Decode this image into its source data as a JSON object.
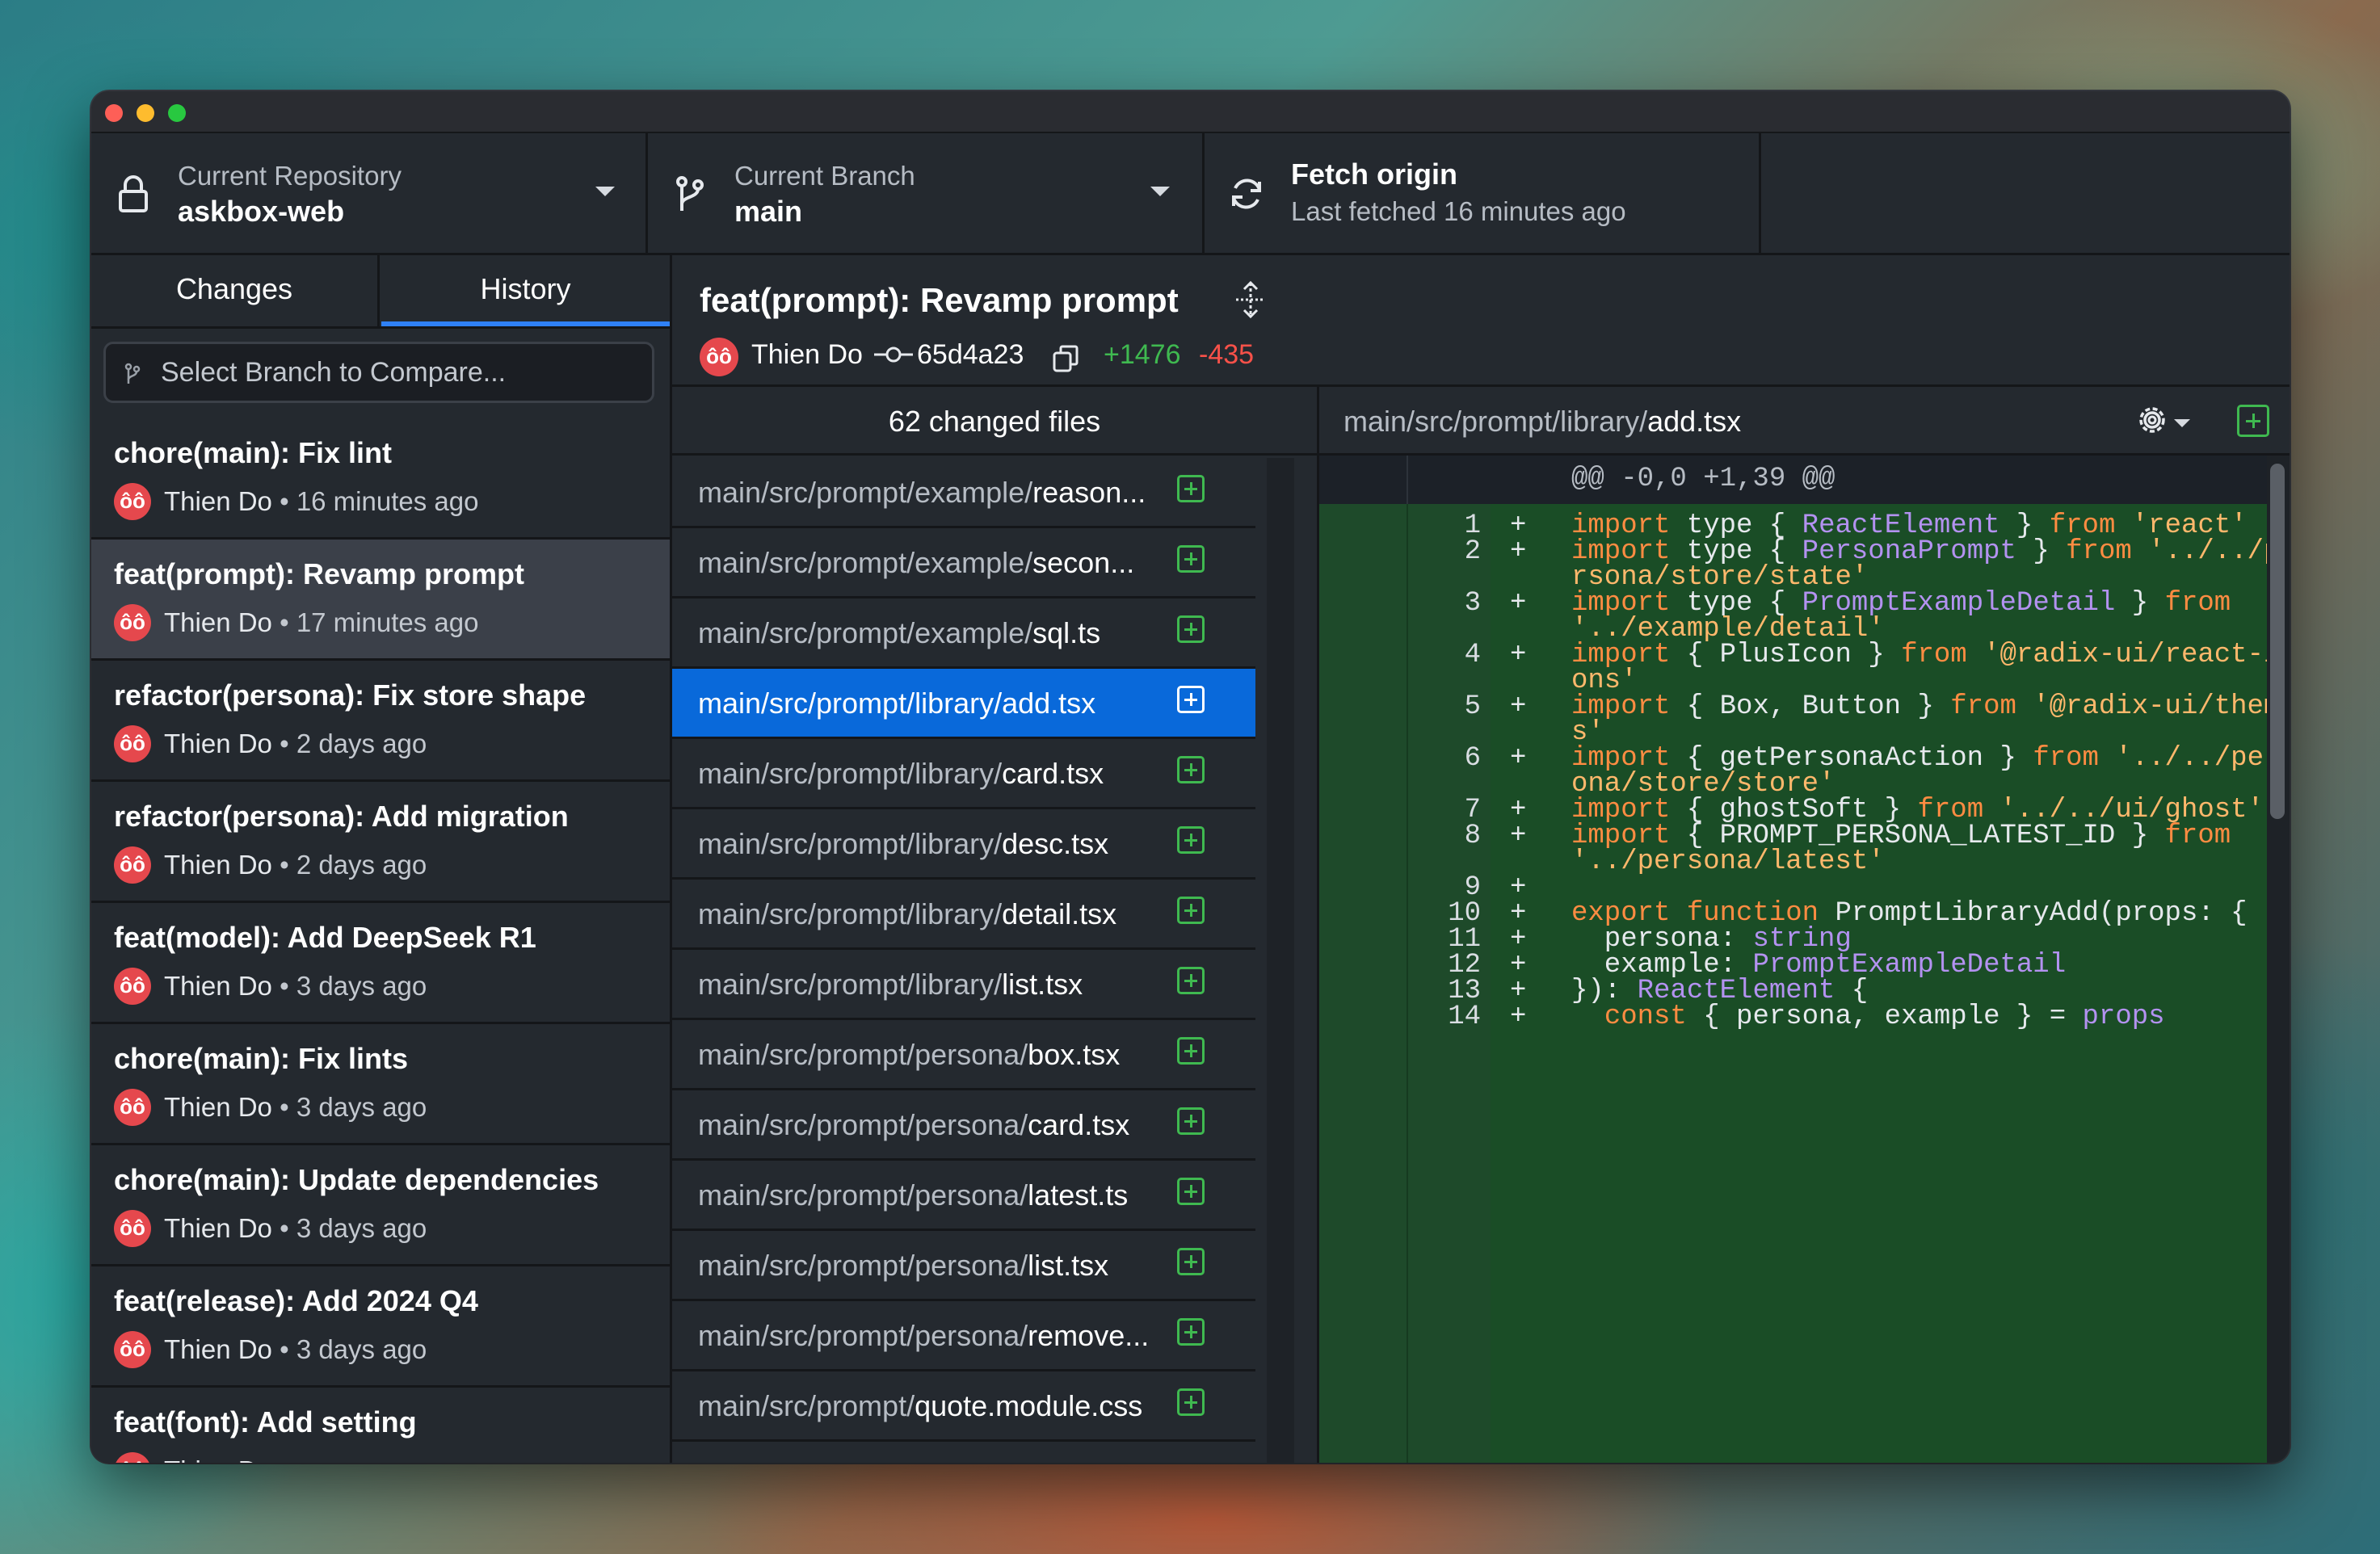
{
  "toolbar": {
    "repository": {
      "label": "Current Repository",
      "value": "askbox-web"
    },
    "branch": {
      "label": "Current Branch",
      "value": "main"
    },
    "fetch": {
      "label": "Fetch origin",
      "status": "Last fetched 16 minutes ago"
    }
  },
  "sidebar": {
    "tabs": [
      {
        "label": "Changes"
      },
      {
        "label": "History"
      }
    ],
    "active_tab": "History",
    "compare_placeholder": "Select Branch to Compare...",
    "commits": [
      {
        "title": "chore(main): Fix lint",
        "avatar": "ôô",
        "author": "Thien Do",
        "time": "16 minutes ago"
      },
      {
        "title": "feat(prompt): Revamp prompt",
        "avatar": "ôô",
        "author": "Thien Do",
        "time": "17 minutes ago"
      },
      {
        "title": "refactor(persona): Fix store shape",
        "avatar": "ôô",
        "author": "Thien Do",
        "time": "2 days ago"
      },
      {
        "title": "refactor(persona): Add migration",
        "avatar": "ôô",
        "author": "Thien Do",
        "time": "2 days ago"
      },
      {
        "title": "feat(model): Add DeepSeek R1",
        "avatar": "ôô",
        "author": "Thien Do",
        "time": "3 days ago"
      },
      {
        "title": "chore(main): Fix lints",
        "avatar": "ôô",
        "author": "Thien Do",
        "time": "3 days ago"
      },
      {
        "title": "chore(main): Update dependencies",
        "avatar": "ôô",
        "author": "Thien Do",
        "time": "3 days ago"
      },
      {
        "title": "feat(release): Add 2024 Q4",
        "avatar": "ôô",
        "author": "Thien Do",
        "time": "3 days ago"
      },
      {
        "title": "feat(font): Add setting",
        "avatar": "ôô",
        "author": "Thien Do",
        "time": ""
      }
    ],
    "meta_separator": "•"
  },
  "commit": {
    "title": "feat(prompt): Revamp prompt",
    "avatar": "ôô",
    "author": "Thien Do",
    "sha": "65d4a23",
    "additions": "+1476",
    "deletions": "-435"
  },
  "files": {
    "header": "62 changed files",
    "items": [
      {
        "dir": "main/src/prompt/example/",
        "name": "reason..."
      },
      {
        "dir": "main/src/prompt/example/",
        "name": "secon..."
      },
      {
        "dir": "main/src/prompt/example/",
        "name": "sql.ts"
      },
      {
        "dir": "main/src/prompt/library/",
        "name": "add.tsx"
      },
      {
        "dir": "main/src/prompt/library/",
        "name": "card.tsx"
      },
      {
        "dir": "main/src/prompt/library/",
        "name": "desc.tsx"
      },
      {
        "dir": "main/src/prompt/library/",
        "name": "detail.tsx"
      },
      {
        "dir": "main/src/prompt/library/",
        "name": "list.tsx"
      },
      {
        "dir": "main/src/prompt/persona/",
        "name": "box.tsx"
      },
      {
        "dir": "main/src/prompt/persona/",
        "name": "card.tsx"
      },
      {
        "dir": "main/src/prompt/persona/",
        "name": "latest.ts"
      },
      {
        "dir": "main/src/prompt/persona/",
        "name": "list.tsx"
      },
      {
        "dir": "main/src/prompt/persona/",
        "name": "remove..."
      },
      {
        "dir": "main/src/prompt/",
        "name": "quote.module.css"
      }
    ]
  },
  "diff": {
    "dir": "main/src/prompt/library/",
    "name": "add.tsx",
    "hunk": "@@ -0,0 +1,39 @@",
    "line_numbers": [
      "1",
      "2",
      "3",
      "4",
      "5",
      "6",
      "7",
      "8",
      "9",
      "10",
      "11",
      "12",
      "13",
      "14"
    ],
    "plus": "+",
    "tokens": {
      "import": "import",
      "type": "type",
      "from": "from",
      "export": "export",
      "function": "function",
      "const": "const",
      "string": "string",
      "ReactElement": "ReactElement",
      "PersonaPrompt": "PersonaPrompt",
      "PromptExampleDetail": "PromptExampleDetail",
      "props": "props"
    },
    "text": {
      "l1a": "{ ",
      "l1b": " } ",
      "l1c": "'react'",
      "l2a": "{ ",
      "l2b": " } ",
      "l2c": "'../../pe",
      "l2d": "rsona/store/state'",
      "l3a": "{ ",
      "l3b": " } ",
      "l3d": "'../example/detail'",
      "l4a": "{ PlusIcon } ",
      "l4c": "'@radix-ui/react-ic",
      "l4d": "ons'",
      "l5a": "{ Box, Button } ",
      "l5c": "'@radix-ui/theme",
      "l5d": "s'",
      "l6a": "{ getPersonaAction } ",
      "l6c": "'../../pers",
      "l6d": "ona/store/store'",
      "l7a": "{ ghostSoft } ",
      "l7c": "'../../ui/ghost'",
      "l8a": "{ PROMPT_PERSONA_LATEST_ID } ",
      "l8d": "'../persona/latest'",
      "l10a": "PromptLibraryAdd(props: {",
      "l11a": "  persona: ",
      "l12a": "  example: ",
      "l13a": "}): ",
      "l13b": " {",
      "l14a": "  ",
      "l14b": " { persona, example } = "
    }
  }
}
